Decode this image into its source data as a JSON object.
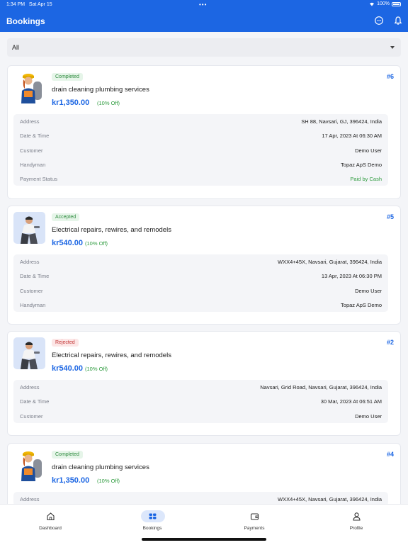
{
  "status_bar": {
    "time": "1:34 PM",
    "date": "Sat Apr 15",
    "battery": "100%"
  },
  "header": {
    "title": "Bookings"
  },
  "filter": {
    "value": "All"
  },
  "bookings": [
    {
      "status": "Completed",
      "id": "#6",
      "service": "drain cleaning plumbing services",
      "price": "kr1,350.00",
      "discount": "(10% Off)",
      "details": [
        {
          "label": "Address",
          "value": "SH 88, Navsari, GJ, 396424, India"
        },
        {
          "label": "Date & Time",
          "value": "17 Apr, 2023 At 06:30 AM"
        },
        {
          "label": "Customer",
          "value": "Demo User"
        },
        {
          "label": "Handyman",
          "value": "Topaz ApS Demo"
        },
        {
          "label": "Payment Status",
          "value": "Paid by Cash"
        }
      ]
    },
    {
      "status": "Accepted",
      "id": "#5",
      "service": "Electrical repairs, rewires, and remodels",
      "price": "kr540.00",
      "discount": "(10% Off)",
      "details": [
        {
          "label": "Address",
          "value": "WXX4+45X, Navsari, Gujarat, 396424, India"
        },
        {
          "label": "Date & Time",
          "value": "13 Apr, 2023 At 06:30 PM"
        },
        {
          "label": "Customer",
          "value": "Demo User"
        },
        {
          "label": "Handyman",
          "value": "Topaz ApS Demo"
        }
      ]
    },
    {
      "status": "Rejected",
      "id": "#2",
      "service": "Electrical repairs, rewires, and remodels",
      "price": "kr540.00",
      "discount": "(10% Off)",
      "details": [
        {
          "label": "Address",
          "value": "Navsari, Grid Road, Navsari, Gujarat, 396424, India"
        },
        {
          "label": "Date & Time",
          "value": "30 Mar, 2023 At 06:51 AM"
        },
        {
          "label": "Customer",
          "value": "Demo User"
        }
      ]
    },
    {
      "status": "Completed",
      "id": "#4",
      "service": "drain cleaning plumbing services",
      "price": "kr1,350.00",
      "discount": "(10% Off)",
      "details": [
        {
          "label": "Address",
          "value": "WXX4+45X, Navsari, Gujarat, 396424, India"
        }
      ]
    }
  ],
  "bottom_nav": [
    {
      "label": "Dashboard",
      "icon": "home-icon"
    },
    {
      "label": "Bookings",
      "icon": "bookings-icon",
      "active": true
    },
    {
      "label": "Payments",
      "icon": "wallet-icon"
    },
    {
      "label": "Profile",
      "icon": "profile-icon"
    }
  ],
  "colors": {
    "primary": "#1C66E3",
    "success": "#2E9B3E",
    "danger": "#C23333"
  }
}
